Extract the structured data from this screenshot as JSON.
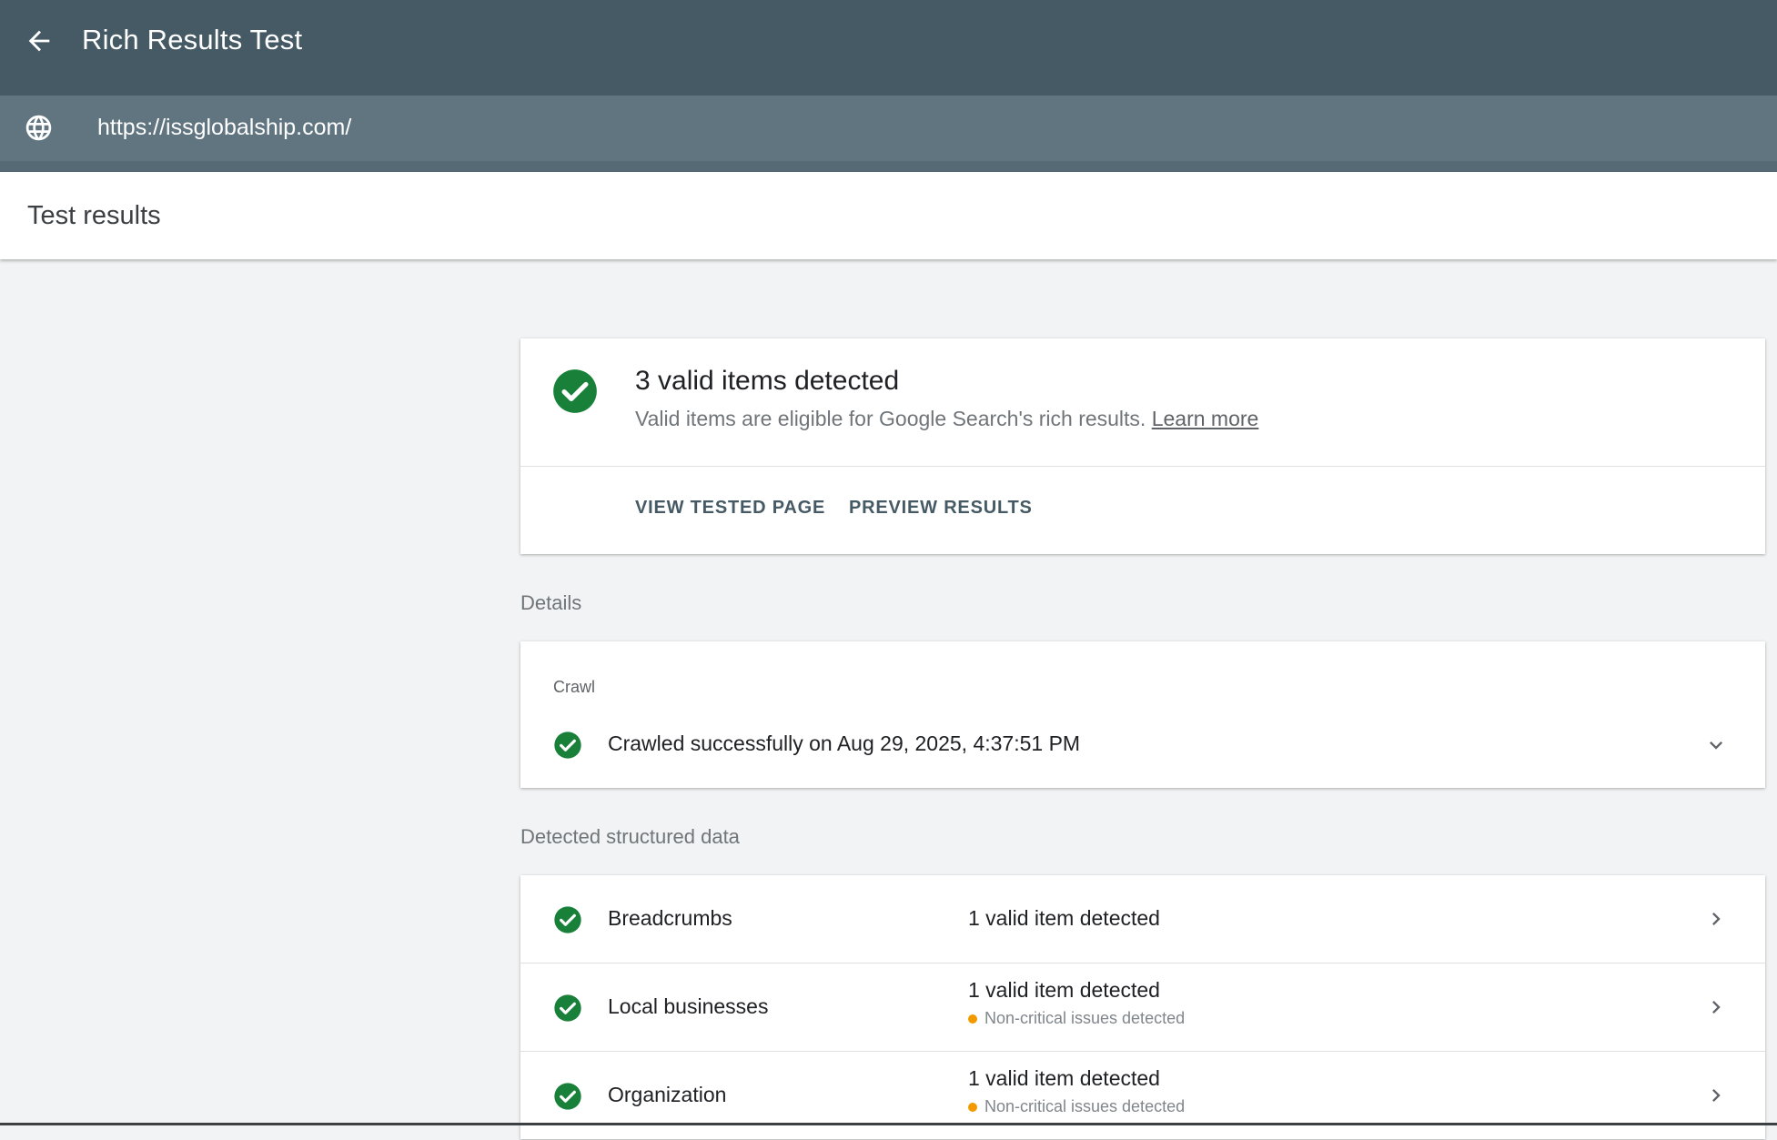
{
  "header": {
    "title": "Rich Results Test",
    "url": "https://issglobalship.com/"
  },
  "results_header": {
    "title": "Test results"
  },
  "summary": {
    "title": "3 valid items detected",
    "subtitle": "Valid items are eligible for Google Search's rich results.",
    "learn_more": "Learn more",
    "view_tested_page": "VIEW TESTED PAGE",
    "preview_results": "PREVIEW RESULTS"
  },
  "details": {
    "label": "Details",
    "crawl_label": "Crawl",
    "crawl_status": "Crawled successfully on Aug 29, 2025, 4:37:51 PM"
  },
  "detected": {
    "label": "Detected structured data",
    "rows": [
      {
        "name": "Breadcrumbs",
        "status": "1 valid item detected",
        "note": ""
      },
      {
        "name": "Local businesses",
        "status": "1 valid item detected",
        "note": "Non-critical issues detected"
      },
      {
        "name": "Organization",
        "status": "1 valid item detected",
        "note": "Non-critical issues detected"
      }
    ]
  },
  "colors": {
    "header_bg": "#455a64",
    "urlbar_bg": "#607580",
    "success_green": "#188038",
    "warning_orange": "#f29900"
  },
  "icons": [
    "back-arrow-icon",
    "globe-icon",
    "check-circle-icon",
    "chevron-down-icon",
    "chevron-right-icon"
  ]
}
